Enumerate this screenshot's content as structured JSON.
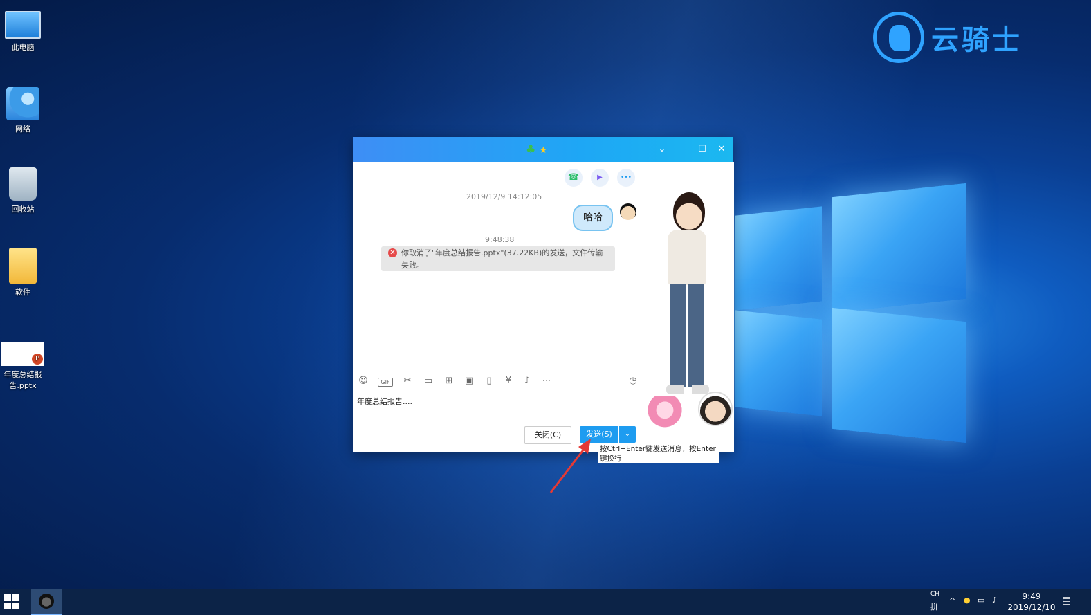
{
  "watermark": {
    "text": "云骑士"
  },
  "desktop_icons": [
    {
      "label": "此电脑"
    },
    {
      "label": "网络"
    },
    {
      "label": "回收站"
    },
    {
      "label": "软件"
    },
    {
      "label": "年度总结报告.pptx"
    }
  ],
  "chat_window": {
    "title_icons": {
      "clover": "♣",
      "star": "★"
    },
    "controls": {
      "dropdown": "⌄",
      "minimize": "—",
      "maximize": "☐",
      "close": "✕"
    },
    "actions": {
      "call": "☎",
      "video": "▶",
      "more": "•••"
    },
    "messages": {
      "timestamp1": "2019/12/9 14:12:05",
      "bubble_text": "哈哈",
      "timestamp2": "9:48:38",
      "system_notice": "你取消了\"年度总结报告.pptx\"(37.22KB)的发送，文件传输失败。"
    },
    "toolbar_icons": [
      "emoji-icon",
      "gif-icon",
      "scissors-icon",
      "folder-icon",
      "apps-icon",
      "image-icon",
      "shake-icon",
      "red-packet-icon",
      "music-icon",
      "more-icon",
      "history-icon"
    ],
    "input_text": "年度总结报告....",
    "buttons": {
      "close": "关闭(C)",
      "send": "发送(S)",
      "send_dropdown": "⌄"
    }
  },
  "tooltip": "按Ctrl+Enter键发送消息，按Enter键换行",
  "taskbar": {
    "ime_lang": "CH",
    "ime_mode": "拼",
    "clock_time": "9:49",
    "clock_date": "2019/12/10"
  },
  "colors": {
    "titlebar": "#1ea7f5",
    "send_button": "#1e9cf0",
    "error": "#e64a4a",
    "bubble": "#cfe9fb",
    "arrow": "#e53935"
  }
}
